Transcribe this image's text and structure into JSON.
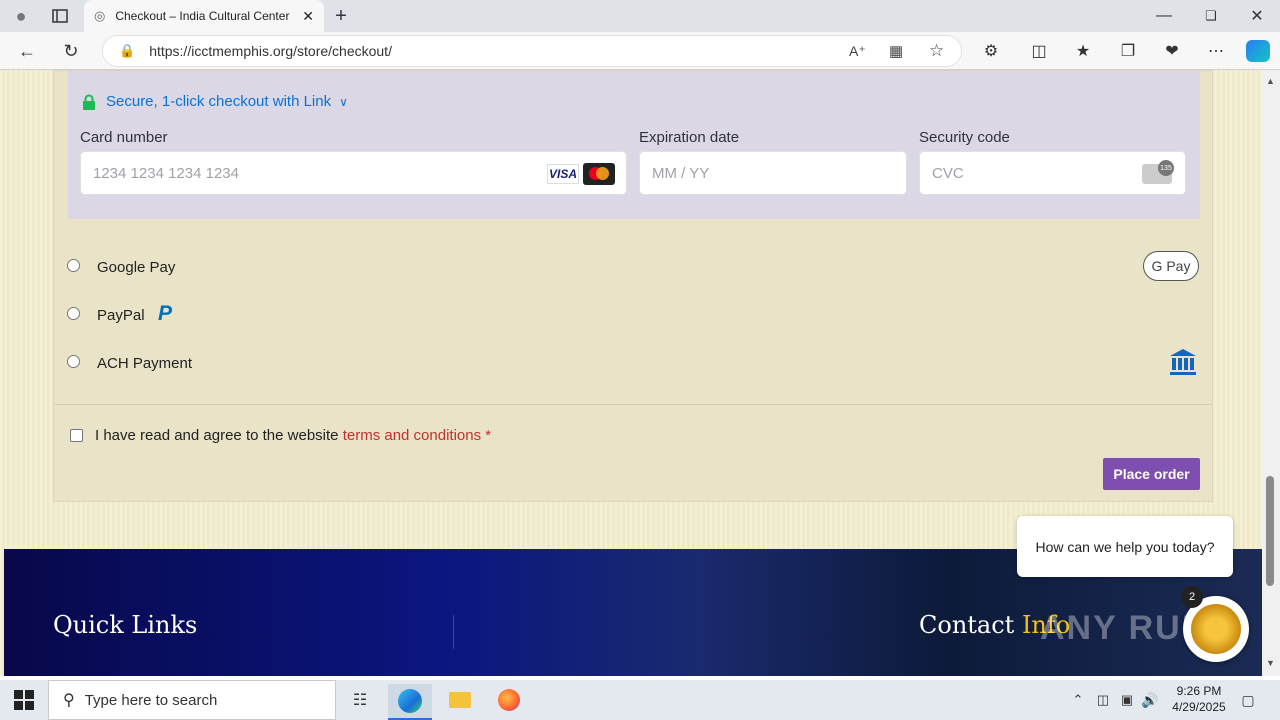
{
  "browser": {
    "tab_title": "Checkout – India Cultural Center",
    "url": "https://icctmemphis.org/store/checkout/"
  },
  "checkout": {
    "link_text": "Secure, 1-click checkout with Link",
    "card_number_label": "Card number",
    "card_number_placeholder": "1234 1234 1234 1234",
    "visa_label": "VISA",
    "expiration_label": "Expiration date",
    "expiration_placeholder": "MM / YY",
    "security_label": "Security code",
    "security_placeholder": "CVC",
    "cvc_badge": "135",
    "options": [
      "Google Pay",
      "PayPal",
      "ACH Payment"
    ],
    "gpay_badge": "G Pay",
    "terms_prefix": "I have read and agree to the website",
    "terms_link": "terms and conditions",
    "terms_required": "*",
    "place_order": "Place order"
  },
  "chat": {
    "prompt": "How can we help you today?",
    "badge_count": "2"
  },
  "footer": {
    "quick_links": "Quick Links",
    "contact": "Contact",
    "info": "Info"
  },
  "watermark": "ANY RUN",
  "taskbar": {
    "search_placeholder": "Type here to search",
    "time": "9:26 PM",
    "date": "4/29/2025"
  },
  "colors": {
    "accent_purple": "#7e4fb0",
    "link_blue": "#0a72d6",
    "terms_red": "#c0322d",
    "footer_navy": "#0b1680"
  }
}
